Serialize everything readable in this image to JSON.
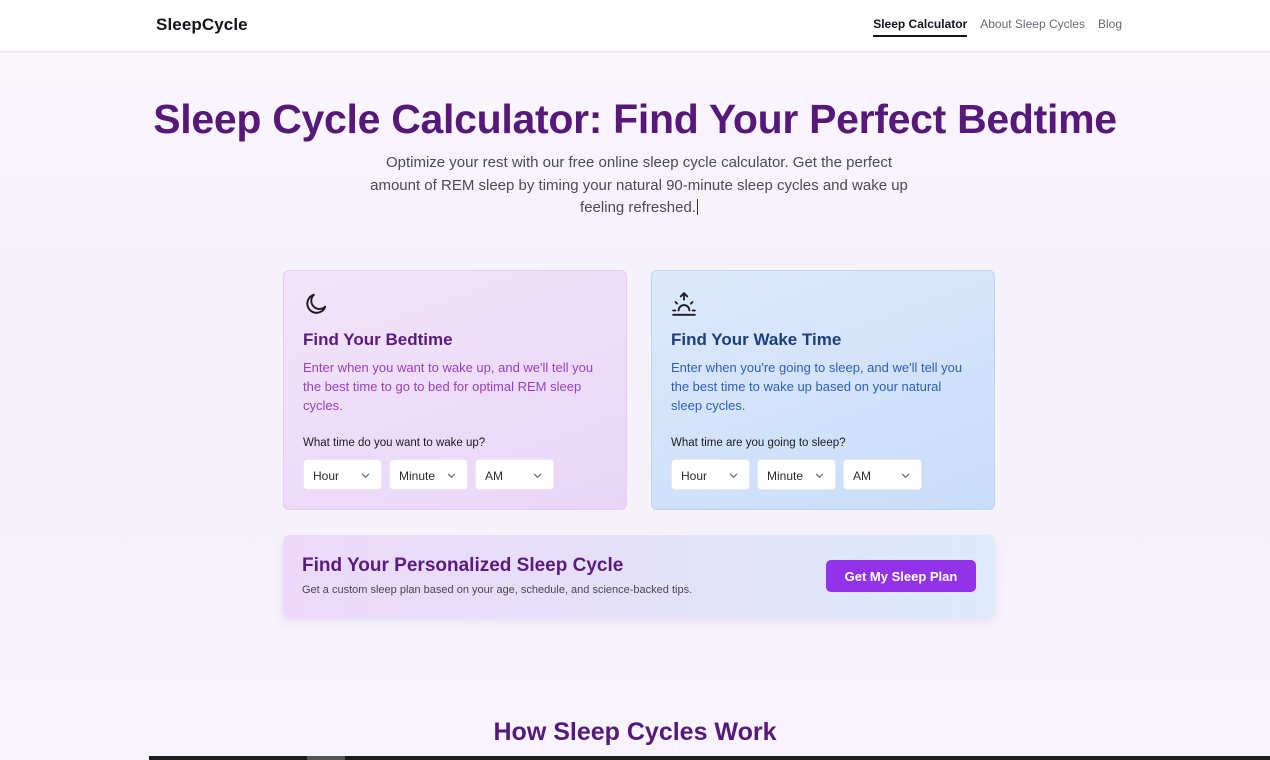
{
  "nav": {
    "logo": "SleepCycle",
    "links": [
      "Sleep Calculator",
      "About Sleep Cycles",
      "Blog"
    ]
  },
  "hero": {
    "title": "Sleep Cycle Calculator: Find Your Perfect Bedtime",
    "subtitle": "Optimize your rest with our free online sleep cycle calculator. Get the perfect amount of REM sleep by timing your natural 90-minute sleep cycles and wake up feeling refreshed."
  },
  "cards": [
    {
      "icon": "moon-icon",
      "title": "Find Your Bedtime",
      "description": "Enter when you want to wake up, and we'll tell you the best time to go to bed for optimal REM sleep cycles.",
      "question": "What time do you want to wake up?",
      "selects": [
        "Hour",
        "Minute",
        "AM"
      ]
    },
    {
      "icon": "sunrise-icon",
      "title": "Find Your Wake Time",
      "description": "Enter when you're going to sleep, and we'll tell you the best time to wake up based on your natural sleep cycles.",
      "question": "What time are you going to sleep?",
      "selects": [
        "Hour",
        "Minute",
        "AM"
      ]
    }
  ],
  "banner": {
    "title": "Find Your Personalized Sleep Cycle",
    "subtitle": "Get a custom sleep plan based on your age, schedule, and science-backed tips.",
    "button": "Get My Sleep Plan"
  },
  "section": {
    "title": "How Sleep Cycles Work"
  },
  "colors": {
    "accent_purple": "#56187a",
    "button_purple": "#9233ea",
    "card_purple_bg": "#eddcfa",
    "card_blue_bg": "#d2e3fb"
  }
}
